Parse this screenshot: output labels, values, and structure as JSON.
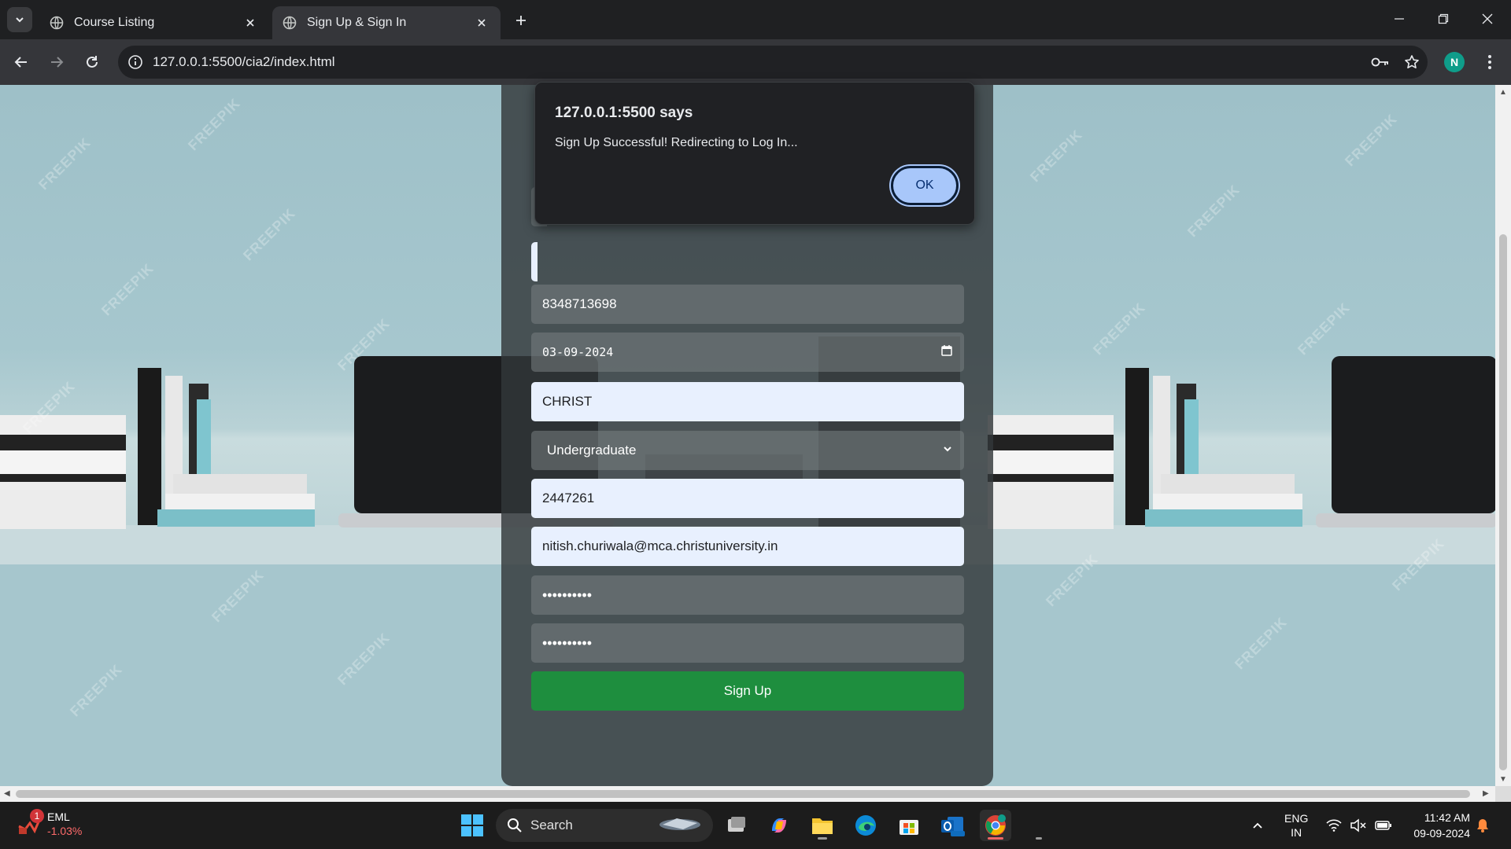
{
  "browser": {
    "tabs": [
      {
        "label": "Course Listing",
        "active": false
      },
      {
        "label": "Sign Up & Sign In",
        "active": true
      }
    ],
    "url": "127.0.0.1:5500/cia2/index.html",
    "profile_initial": "N"
  },
  "form": {
    "phone": "8348713698",
    "dob": "03-09-2024",
    "college": "CHRIST",
    "program": "Undergraduate",
    "register_no": "2447261",
    "email": "nitish.churiwala@mca.christuniversity.in",
    "password_mask": "••••••••••",
    "confirm_password_mask": "••••••••••",
    "submit_label": "Sign Up"
  },
  "dialog": {
    "title": "127.0.0.1:5500 says",
    "message": "Sign Up Successful! Redirecting to Log In...",
    "ok_label": "OK"
  },
  "taskbar": {
    "stock_name": "EML",
    "stock_change": "-1.03%",
    "stock_badge": "1",
    "search_label": "Search",
    "lang_line1": "ENG",
    "lang_line2": "IN",
    "time": "11:42 AM",
    "date": "09-09-2024"
  },
  "watermark_text": "FREEPIK",
  "colors": {
    "submit_green": "#1e8e3e",
    "dialog_ok": "#a8c7fa",
    "autofill_bg": "#e8f0fe"
  }
}
